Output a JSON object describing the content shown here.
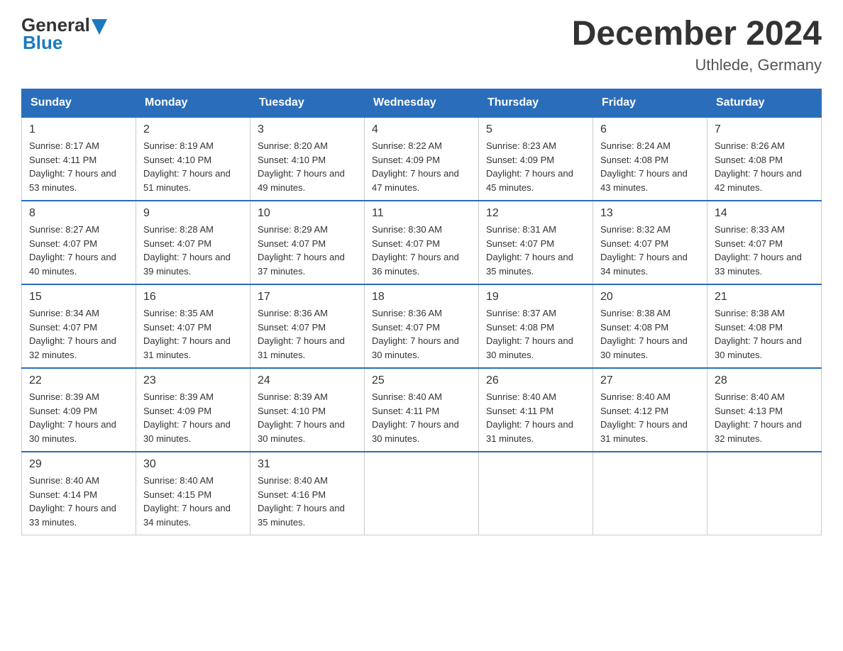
{
  "header": {
    "logo_general": "General",
    "logo_blue": "Blue",
    "title": "December 2024",
    "subtitle": "Uthlede, Germany"
  },
  "weekdays": [
    "Sunday",
    "Monday",
    "Tuesday",
    "Wednesday",
    "Thursday",
    "Friday",
    "Saturday"
  ],
  "weeks": [
    [
      {
        "day": "1",
        "sunrise": "8:17 AM",
        "sunset": "4:11 PM",
        "daylight": "7 hours and 53 minutes."
      },
      {
        "day": "2",
        "sunrise": "8:19 AM",
        "sunset": "4:10 PM",
        "daylight": "7 hours and 51 minutes."
      },
      {
        "day": "3",
        "sunrise": "8:20 AM",
        "sunset": "4:10 PM",
        "daylight": "7 hours and 49 minutes."
      },
      {
        "day": "4",
        "sunrise": "8:22 AM",
        "sunset": "4:09 PM",
        "daylight": "7 hours and 47 minutes."
      },
      {
        "day": "5",
        "sunrise": "8:23 AM",
        "sunset": "4:09 PM",
        "daylight": "7 hours and 45 minutes."
      },
      {
        "day": "6",
        "sunrise": "8:24 AM",
        "sunset": "4:08 PM",
        "daylight": "7 hours and 43 minutes."
      },
      {
        "day": "7",
        "sunrise": "8:26 AM",
        "sunset": "4:08 PM",
        "daylight": "7 hours and 42 minutes."
      }
    ],
    [
      {
        "day": "8",
        "sunrise": "8:27 AM",
        "sunset": "4:07 PM",
        "daylight": "7 hours and 40 minutes."
      },
      {
        "day": "9",
        "sunrise": "8:28 AM",
        "sunset": "4:07 PM",
        "daylight": "7 hours and 39 minutes."
      },
      {
        "day": "10",
        "sunrise": "8:29 AM",
        "sunset": "4:07 PM",
        "daylight": "7 hours and 37 minutes."
      },
      {
        "day": "11",
        "sunrise": "8:30 AM",
        "sunset": "4:07 PM",
        "daylight": "7 hours and 36 minutes."
      },
      {
        "day": "12",
        "sunrise": "8:31 AM",
        "sunset": "4:07 PM",
        "daylight": "7 hours and 35 minutes."
      },
      {
        "day": "13",
        "sunrise": "8:32 AM",
        "sunset": "4:07 PM",
        "daylight": "7 hours and 34 minutes."
      },
      {
        "day": "14",
        "sunrise": "8:33 AM",
        "sunset": "4:07 PM",
        "daylight": "7 hours and 33 minutes."
      }
    ],
    [
      {
        "day": "15",
        "sunrise": "8:34 AM",
        "sunset": "4:07 PM",
        "daylight": "7 hours and 32 minutes."
      },
      {
        "day": "16",
        "sunrise": "8:35 AM",
        "sunset": "4:07 PM",
        "daylight": "7 hours and 31 minutes."
      },
      {
        "day": "17",
        "sunrise": "8:36 AM",
        "sunset": "4:07 PM",
        "daylight": "7 hours and 31 minutes."
      },
      {
        "day": "18",
        "sunrise": "8:36 AM",
        "sunset": "4:07 PM",
        "daylight": "7 hours and 30 minutes."
      },
      {
        "day": "19",
        "sunrise": "8:37 AM",
        "sunset": "4:08 PM",
        "daylight": "7 hours and 30 minutes."
      },
      {
        "day": "20",
        "sunrise": "8:38 AM",
        "sunset": "4:08 PM",
        "daylight": "7 hours and 30 minutes."
      },
      {
        "day": "21",
        "sunrise": "8:38 AM",
        "sunset": "4:08 PM",
        "daylight": "7 hours and 30 minutes."
      }
    ],
    [
      {
        "day": "22",
        "sunrise": "8:39 AM",
        "sunset": "4:09 PM",
        "daylight": "7 hours and 30 minutes."
      },
      {
        "day": "23",
        "sunrise": "8:39 AM",
        "sunset": "4:09 PM",
        "daylight": "7 hours and 30 minutes."
      },
      {
        "day": "24",
        "sunrise": "8:39 AM",
        "sunset": "4:10 PM",
        "daylight": "7 hours and 30 minutes."
      },
      {
        "day": "25",
        "sunrise": "8:40 AM",
        "sunset": "4:11 PM",
        "daylight": "7 hours and 30 minutes."
      },
      {
        "day": "26",
        "sunrise": "8:40 AM",
        "sunset": "4:11 PM",
        "daylight": "7 hours and 31 minutes."
      },
      {
        "day": "27",
        "sunrise": "8:40 AM",
        "sunset": "4:12 PM",
        "daylight": "7 hours and 31 minutes."
      },
      {
        "day": "28",
        "sunrise": "8:40 AM",
        "sunset": "4:13 PM",
        "daylight": "7 hours and 32 minutes."
      }
    ],
    [
      {
        "day": "29",
        "sunrise": "8:40 AM",
        "sunset": "4:14 PM",
        "daylight": "7 hours and 33 minutes."
      },
      {
        "day": "30",
        "sunrise": "8:40 AM",
        "sunset": "4:15 PM",
        "daylight": "7 hours and 34 minutes."
      },
      {
        "day": "31",
        "sunrise": "8:40 AM",
        "sunset": "4:16 PM",
        "daylight": "7 hours and 35 minutes."
      },
      null,
      null,
      null,
      null
    ]
  ]
}
